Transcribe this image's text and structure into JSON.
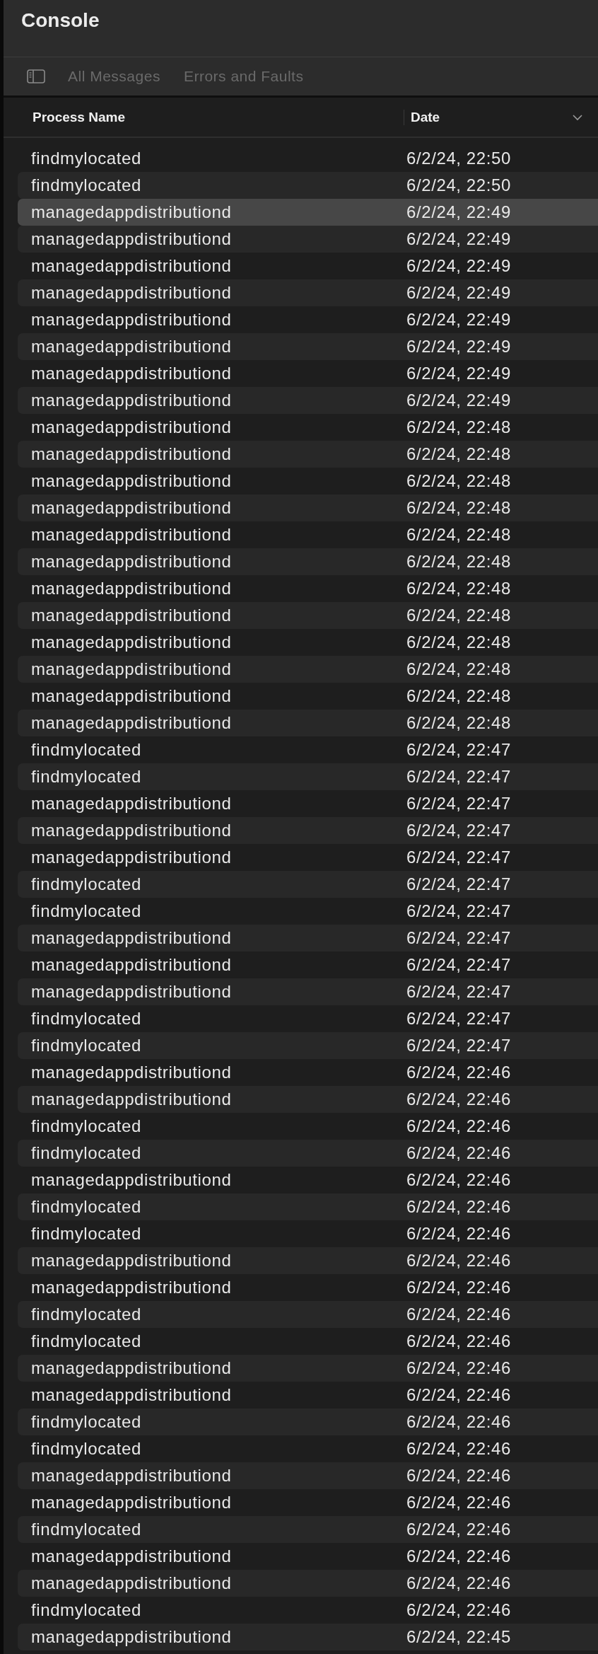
{
  "window": {
    "title": "Console"
  },
  "toolbar": {
    "filters": [
      {
        "label": "All Messages",
        "disabled": true
      },
      {
        "label": "Errors and Faults",
        "disabled": true
      }
    ]
  },
  "table": {
    "columns": [
      "Process Name",
      "Date"
    ],
    "rows": [
      {
        "process": "findmylocated",
        "date": "6/2/24, 22:50",
        "selected": false
      },
      {
        "process": "findmylocated",
        "date": "6/2/24, 22:50",
        "selected": false
      },
      {
        "process": "managedappdistributiond",
        "date": "6/2/24, 22:49",
        "selected": true
      },
      {
        "process": "managedappdistributiond",
        "date": "6/2/24, 22:49",
        "selected": false
      },
      {
        "process": "managedappdistributiond",
        "date": "6/2/24, 22:49",
        "selected": false
      },
      {
        "process": "managedappdistributiond",
        "date": "6/2/24, 22:49",
        "selected": false
      },
      {
        "process": "managedappdistributiond",
        "date": "6/2/24, 22:49",
        "selected": false
      },
      {
        "process": "managedappdistributiond",
        "date": "6/2/24, 22:49",
        "selected": false
      },
      {
        "process": "managedappdistributiond",
        "date": "6/2/24, 22:49",
        "selected": false
      },
      {
        "process": "managedappdistributiond",
        "date": "6/2/24, 22:49",
        "selected": false
      },
      {
        "process": "managedappdistributiond",
        "date": "6/2/24, 22:48",
        "selected": false
      },
      {
        "process": "managedappdistributiond",
        "date": "6/2/24, 22:48",
        "selected": false
      },
      {
        "process": "managedappdistributiond",
        "date": "6/2/24, 22:48",
        "selected": false
      },
      {
        "process": "managedappdistributiond",
        "date": "6/2/24, 22:48",
        "selected": false
      },
      {
        "process": "managedappdistributiond",
        "date": "6/2/24, 22:48",
        "selected": false
      },
      {
        "process": "managedappdistributiond",
        "date": "6/2/24, 22:48",
        "selected": false
      },
      {
        "process": "managedappdistributiond",
        "date": "6/2/24, 22:48",
        "selected": false
      },
      {
        "process": "managedappdistributiond",
        "date": "6/2/24, 22:48",
        "selected": false
      },
      {
        "process": "managedappdistributiond",
        "date": "6/2/24, 22:48",
        "selected": false
      },
      {
        "process": "managedappdistributiond",
        "date": "6/2/24, 22:48",
        "selected": false
      },
      {
        "process": "managedappdistributiond",
        "date": "6/2/24, 22:48",
        "selected": false
      },
      {
        "process": "managedappdistributiond",
        "date": "6/2/24, 22:48",
        "selected": false
      },
      {
        "process": "findmylocated",
        "date": "6/2/24, 22:47",
        "selected": false
      },
      {
        "process": "findmylocated",
        "date": "6/2/24, 22:47",
        "selected": false
      },
      {
        "process": "managedappdistributiond",
        "date": "6/2/24, 22:47",
        "selected": false
      },
      {
        "process": "managedappdistributiond",
        "date": "6/2/24, 22:47",
        "selected": false
      },
      {
        "process": "managedappdistributiond",
        "date": "6/2/24, 22:47",
        "selected": false
      },
      {
        "process": "findmylocated",
        "date": "6/2/24, 22:47",
        "selected": false
      },
      {
        "process": "findmylocated",
        "date": "6/2/24, 22:47",
        "selected": false
      },
      {
        "process": "managedappdistributiond",
        "date": "6/2/24, 22:47",
        "selected": false
      },
      {
        "process": "managedappdistributiond",
        "date": "6/2/24, 22:47",
        "selected": false
      },
      {
        "process": "managedappdistributiond",
        "date": "6/2/24, 22:47",
        "selected": false
      },
      {
        "process": "findmylocated",
        "date": "6/2/24, 22:47",
        "selected": false
      },
      {
        "process": "findmylocated",
        "date": "6/2/24, 22:47",
        "selected": false
      },
      {
        "process": "managedappdistributiond",
        "date": "6/2/24, 22:46",
        "selected": false
      },
      {
        "process": "managedappdistributiond",
        "date": "6/2/24, 22:46",
        "selected": false
      },
      {
        "process": "findmylocated",
        "date": "6/2/24, 22:46",
        "selected": false
      },
      {
        "process": "findmylocated",
        "date": "6/2/24, 22:46",
        "selected": false
      },
      {
        "process": "managedappdistributiond",
        "date": "6/2/24, 22:46",
        "selected": false
      },
      {
        "process": "findmylocated",
        "date": "6/2/24, 22:46",
        "selected": false
      },
      {
        "process": "findmylocated",
        "date": "6/2/24, 22:46",
        "selected": false
      },
      {
        "process": "managedappdistributiond",
        "date": "6/2/24, 22:46",
        "selected": false
      },
      {
        "process": "managedappdistributiond",
        "date": "6/2/24, 22:46",
        "selected": false
      },
      {
        "process": "findmylocated",
        "date": "6/2/24, 22:46",
        "selected": false
      },
      {
        "process": "findmylocated",
        "date": "6/2/24, 22:46",
        "selected": false
      },
      {
        "process": "managedappdistributiond",
        "date": "6/2/24, 22:46",
        "selected": false
      },
      {
        "process": "managedappdistributiond",
        "date": "6/2/24, 22:46",
        "selected": false
      },
      {
        "process": "findmylocated",
        "date": "6/2/24, 22:46",
        "selected": false
      },
      {
        "process": "findmylocated",
        "date": "6/2/24, 22:46",
        "selected": false
      },
      {
        "process": "managedappdistributiond",
        "date": "6/2/24, 22:46",
        "selected": false
      },
      {
        "process": "managedappdistributiond",
        "date": "6/2/24, 22:46",
        "selected": false
      },
      {
        "process": "findmylocated",
        "date": "6/2/24, 22:46",
        "selected": false
      },
      {
        "process": "managedappdistributiond",
        "date": "6/2/24, 22:46",
        "selected": false
      },
      {
        "process": "managedappdistributiond",
        "date": "6/2/24, 22:46",
        "selected": false
      },
      {
        "process": "findmylocated",
        "date": "6/2/24, 22:46",
        "selected": false
      },
      {
        "process": "managedappdistributiond",
        "date": "6/2/24, 22:45",
        "selected": false
      }
    ]
  }
}
